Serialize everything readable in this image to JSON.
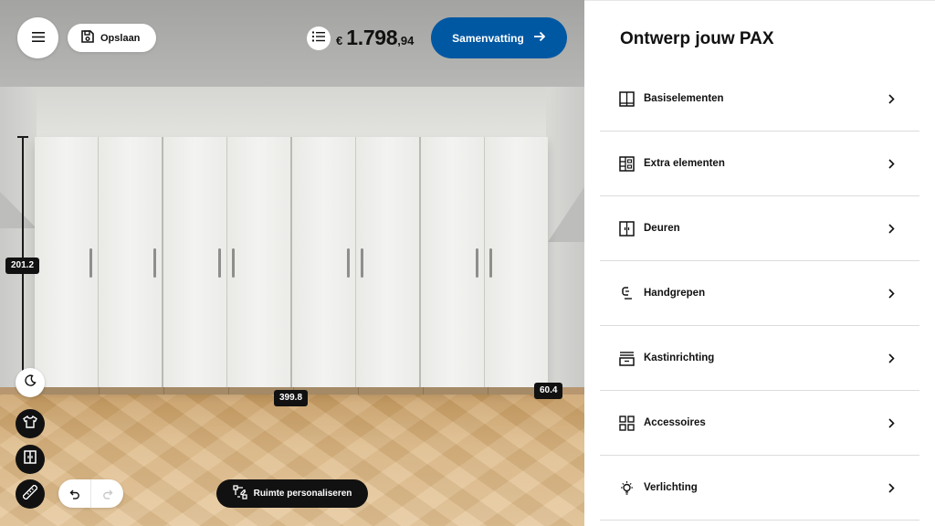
{
  "header": {
    "save_label": "Opslaan",
    "price_currency": "€",
    "price_main": "1.798",
    "price_cents": ",94",
    "summary_label": "Samenvatting"
  },
  "scene": {
    "height_dimension": "201.2",
    "width_dimension": "399.8",
    "depth_dimension": "60.4",
    "personalize_label": "Ruimte personaliseren"
  },
  "panel": {
    "title": "Ontwerp jouw PAX",
    "items": [
      {
        "label": "Basiselementen",
        "icon": "frame-icon"
      },
      {
        "label": "Extra elementen",
        "icon": "shelves-icon"
      },
      {
        "label": "Deuren",
        "icon": "door-icon"
      },
      {
        "label": "Handgrepen",
        "icon": "handle-icon"
      },
      {
        "label": "Kastinrichting",
        "icon": "drawer-icon"
      },
      {
        "label": "Accessoires",
        "icon": "grid-icon"
      },
      {
        "label": "Verlichting",
        "icon": "lightbulb-icon"
      }
    ]
  },
  "colors": {
    "primary_blue": "#0058a3",
    "dark": "#111111",
    "panel_bg": "#ffffff"
  }
}
